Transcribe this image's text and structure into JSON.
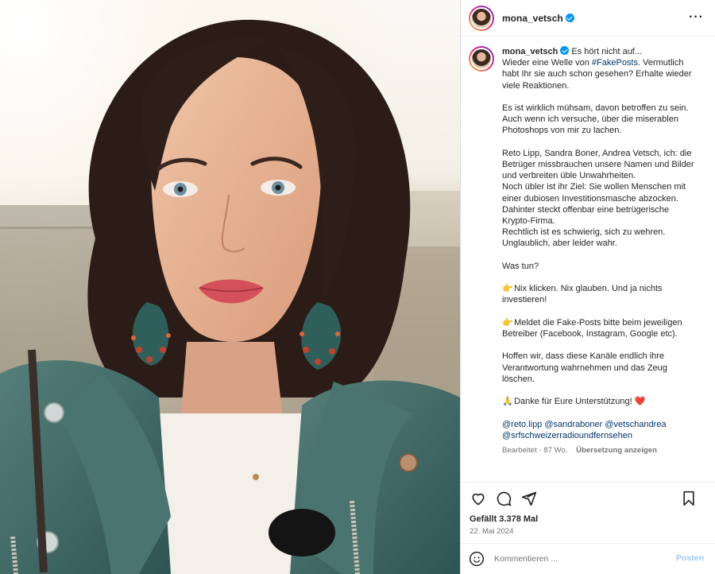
{
  "header": {
    "username": "mona_vetsch",
    "more_icon": "more-horizontal-icon"
  },
  "caption": {
    "username": "mona_vetsch",
    "first_line": "Es hört nicht auf...",
    "p1_before": "Wieder eine Welle von ",
    "hashtag": "#FakePosts",
    "p1_after": ". Vermutlich habt Ihr sie auch schon gesehen? Erhalte wieder viele Reaktionen.",
    "p2": "Es ist wirklich mühsam, davon betroffen zu sein. Auch wenn ich versuche, über die miserablen Photoshops von mir zu lachen.",
    "p3_line1": "Reto Lipp, Sandra Boner, Andrea Vetsch, ich: die Betrüger missbrauchen unsere Namen und Bilder und verbreiten üble Unwahrheiten.",
    "p3_line2": "Noch übler ist ihr Ziel: Sie wollen Menschen mit einer dubiosen Investitionsmasche abzocken.",
    "p3_line3": "Dahinter steckt offenbar eine betrügerische Krypto-Firma.",
    "p3_line4": "Rechtlich ist es schwierig, sich zu wehren.",
    "p3_line5": "Unglaublich, aber leider wahr.",
    "p4": "Was tun?",
    "p5_emoji": "👉",
    "p5": "Nix klicken. Nix glauben. Und ja nichts investieren!",
    "p6_emoji": "👉",
    "p6": "Meldet die Fake-Posts bitte beim jeweiligen Betreiber (Facebook, Instagram, Google etc).",
    "p7": "Hoffen wir, dass diese Kanäle endlich ihre Verantwortung wahrnehmen und das Zeug löschen.",
    "p8_emoji": "🙏",
    "p8": "Danke für Eure Unterstützung!",
    "p8_heart": "❤️",
    "mentions": [
      "@reto.lipp",
      "@sandraboner",
      "@vetschandrea",
      "@srfschweizerradioundfernsehen"
    ],
    "edited": "Bearbeitet · 87 Wo.",
    "translate": "Übersetzung anzeigen"
  },
  "actions": {
    "like_icon": "heart-icon",
    "comment_icon": "comment-icon",
    "share_icon": "share-icon",
    "save_icon": "bookmark-icon"
  },
  "likes": "Gefällt 3.378 Mal",
  "date": "22. Mai 2024",
  "comment": {
    "placeholder": "Kommentieren ...",
    "post_label": "Posten",
    "emoji_icon": "emoji-icon"
  },
  "colors": {
    "link": "#00376b",
    "verified": "#0095f6",
    "muted": "#737373",
    "post_button": "#9ec9f6"
  }
}
